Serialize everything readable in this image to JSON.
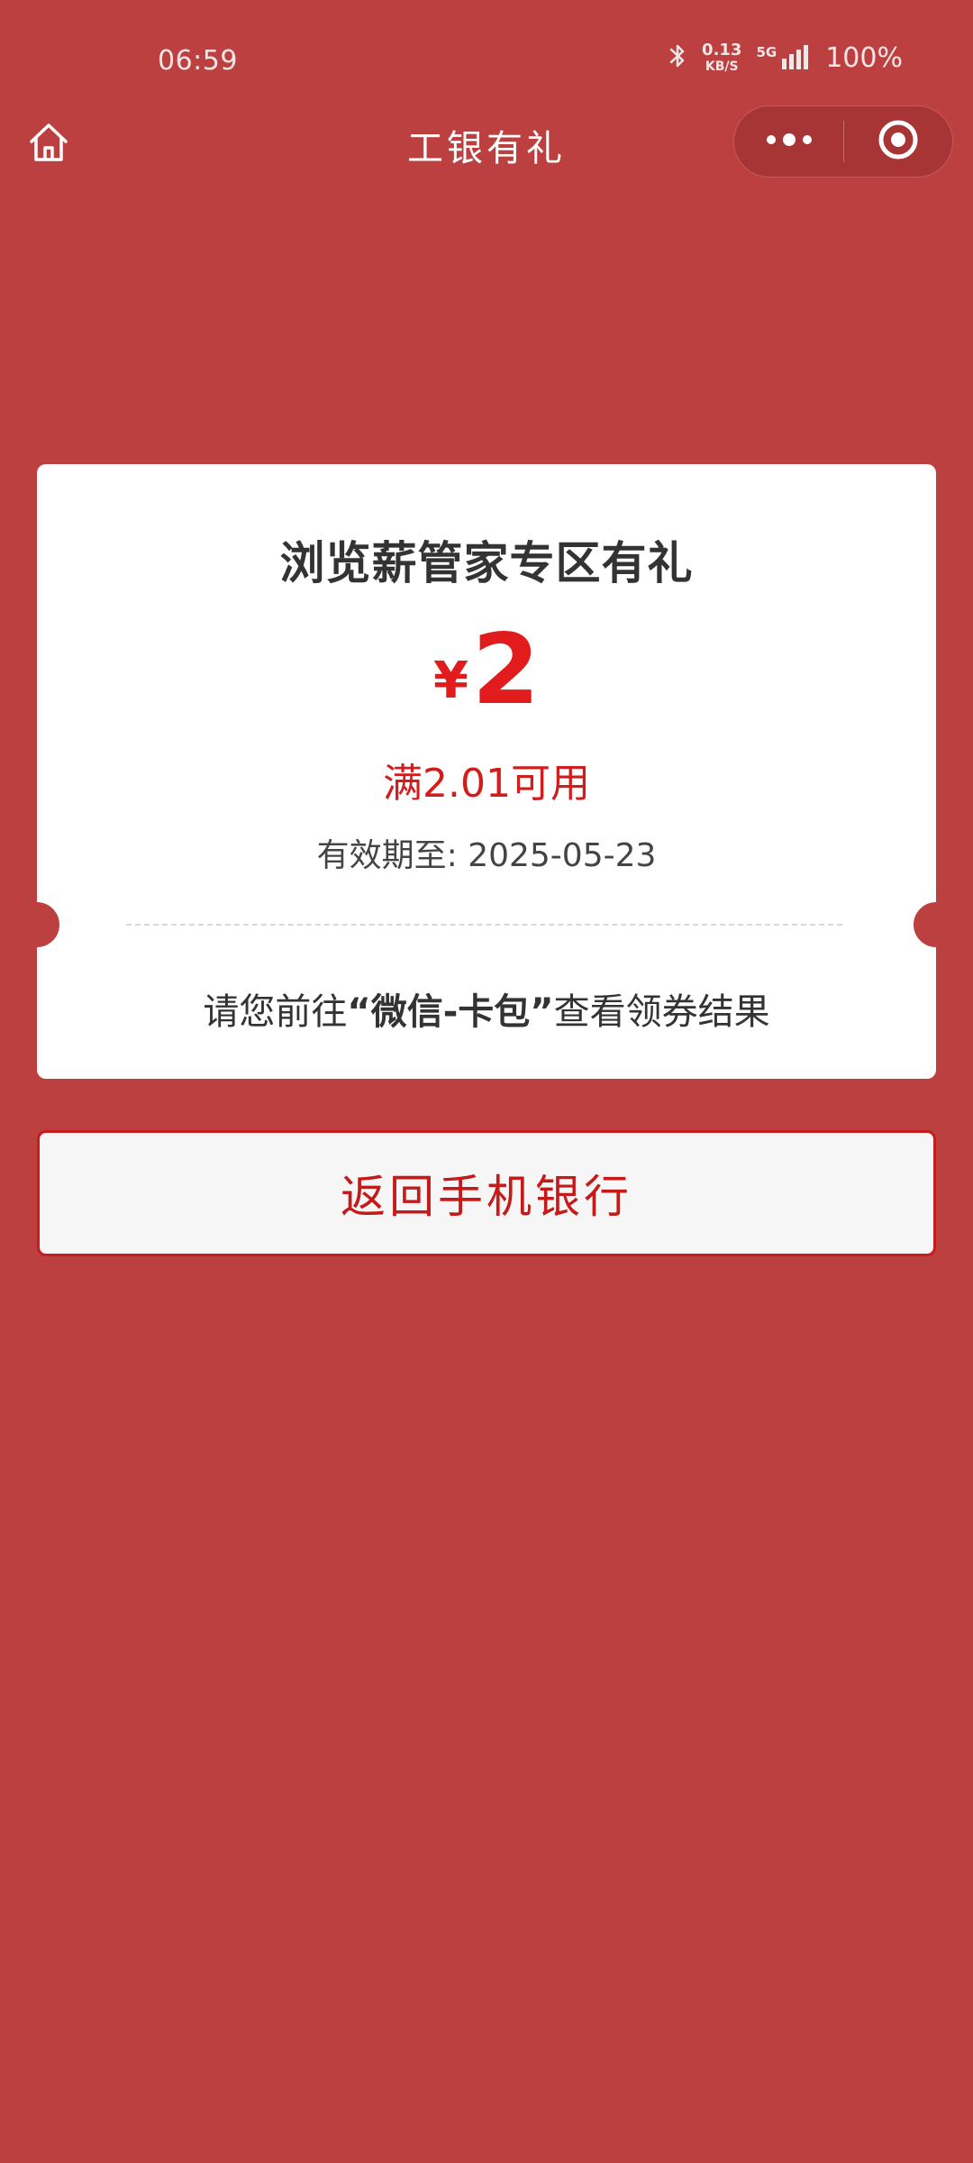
{
  "status_bar": {
    "time": "06:59",
    "net_speed": "0.13",
    "net_unit": "KB/S",
    "network": "5G",
    "battery": "100%"
  },
  "nav": {
    "title": "工银有礼",
    "icons": {
      "home": "home-icon",
      "more": "more-dots-icon",
      "close": "target-close-icon"
    }
  },
  "coupon": {
    "title": "浏览薪管家专区有礼",
    "currency": "¥",
    "amount": "2",
    "condition": "满2.01可用",
    "validity_label": "有效期至:",
    "validity_date": "2025-05-23",
    "hint_prefix": "请您前往",
    "hint_emphasis": "“微信-卡包”",
    "hint_suffix": "查看领券结果"
  },
  "actions": {
    "return_label": "返回手机银行"
  },
  "colors": {
    "background": "#bd4040",
    "accent_red": "#e21c1c",
    "card": "#ffffff",
    "button_border": "#c81b1b"
  }
}
